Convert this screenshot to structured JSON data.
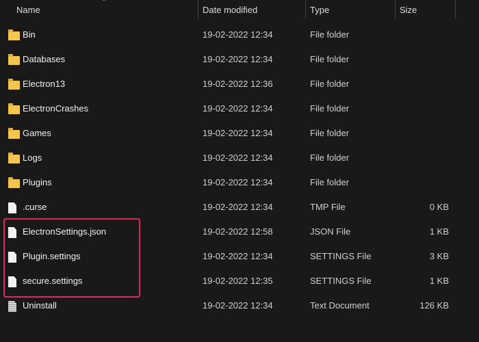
{
  "columns": {
    "name": "Name",
    "date": "Date modified",
    "type": "Type",
    "size": "Size"
  },
  "highlight_color": "#e0245e",
  "rows": [
    {
      "icon": "folder-icon",
      "name": "Bin",
      "date": "19-02-2022 12:34",
      "type": "File folder",
      "size": ""
    },
    {
      "icon": "folder-icon",
      "name": "Databases",
      "date": "19-02-2022 12:34",
      "type": "File folder",
      "size": ""
    },
    {
      "icon": "folder-icon",
      "name": "Electron13",
      "date": "19-02-2022 12:36",
      "type": "File folder",
      "size": ""
    },
    {
      "icon": "folder-icon",
      "name": "ElectronCrashes",
      "date": "19-02-2022 12:34",
      "type": "File folder",
      "size": ""
    },
    {
      "icon": "folder-icon",
      "name": "Games",
      "date": "19-02-2022 12:34",
      "type": "File folder",
      "size": ""
    },
    {
      "icon": "folder-icon",
      "name": "Logs",
      "date": "19-02-2022 12:34",
      "type": "File folder",
      "size": ""
    },
    {
      "icon": "folder-icon",
      "name": "Plugins",
      "date": "19-02-2022 12:34",
      "type": "File folder",
      "size": ""
    },
    {
      "icon": "file-icon",
      "name": ".curse",
      "date": "19-02-2022 12:34",
      "type": "TMP File",
      "size": "0 KB"
    },
    {
      "icon": "file-icon",
      "name": "ElectronSettings.json",
      "date": "19-02-2022 12:58",
      "type": "JSON File",
      "size": "1 KB"
    },
    {
      "icon": "file-icon",
      "name": "Plugin.settings",
      "date": "19-02-2022 12:34",
      "type": "SETTINGS File",
      "size": "3 KB"
    },
    {
      "icon": "file-icon",
      "name": "secure.settings",
      "date": "19-02-2022 12:35",
      "type": "SETTINGS File",
      "size": "1 KB"
    },
    {
      "icon": "text-document-icon",
      "name": "Uninstall",
      "date": "19-02-2022 12:34",
      "type": "Text Document",
      "size": "126 KB"
    }
  ]
}
